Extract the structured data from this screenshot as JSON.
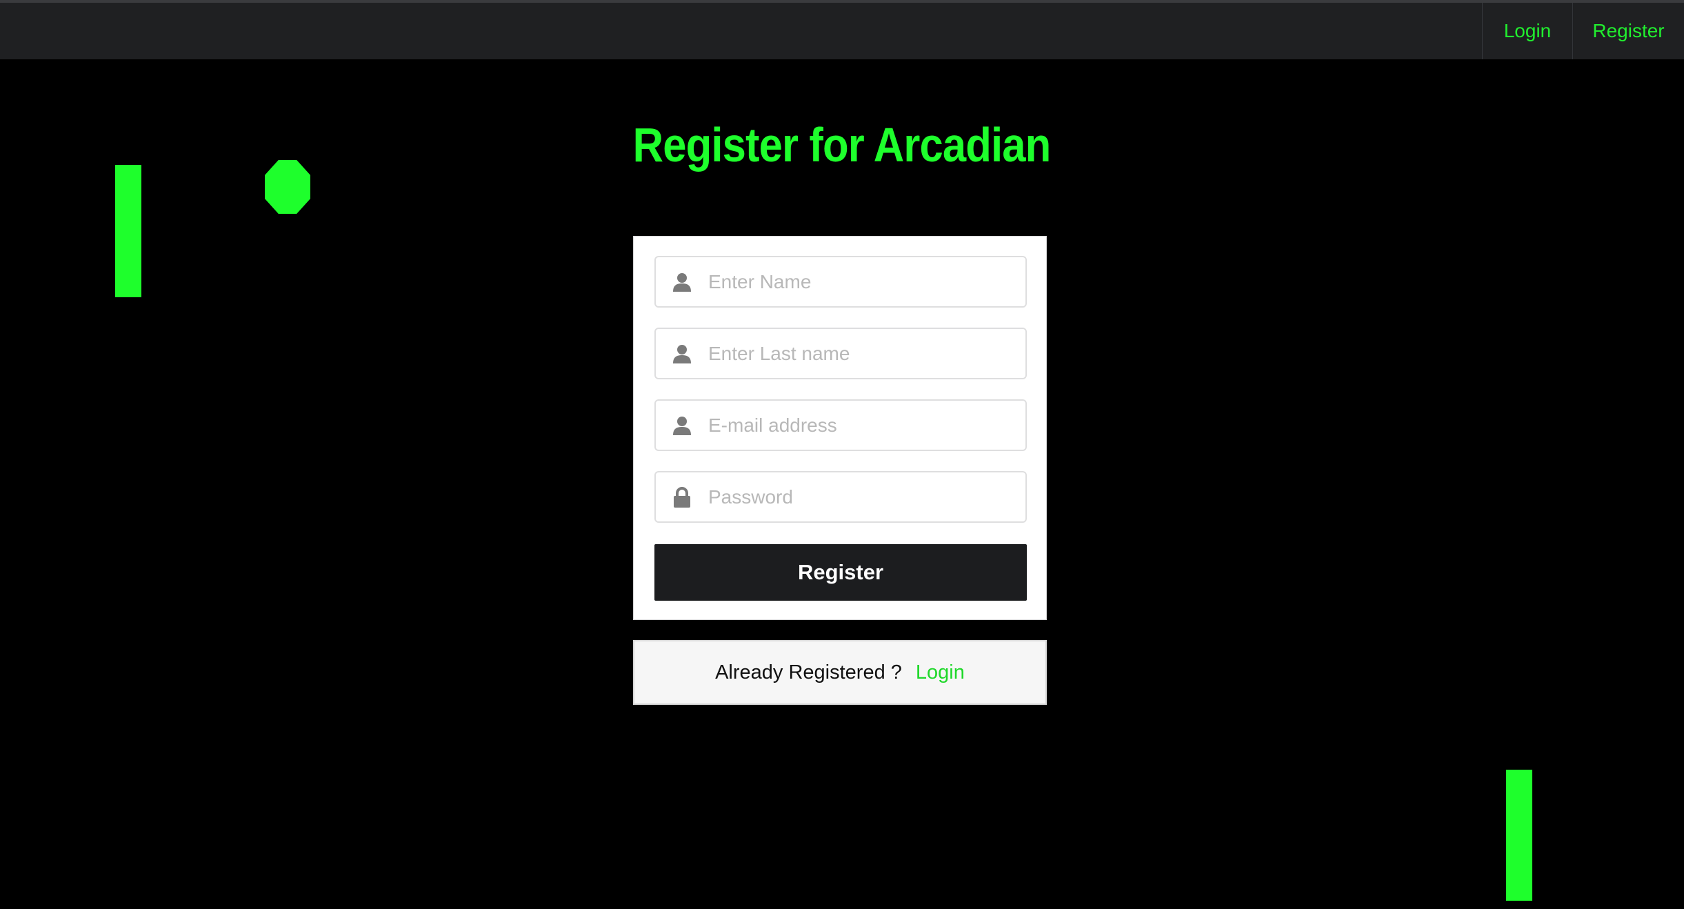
{
  "nav": {
    "login_label": "Login",
    "register_label": "Register"
  },
  "title": "Register for Arcadian",
  "form": {
    "name_placeholder": "Enter Name",
    "last_name_placeholder": "Enter Last name",
    "email_placeholder": "E-mail address",
    "password_placeholder": "Password",
    "submit_label": "Register"
  },
  "message": {
    "text": "Already Registered ?",
    "link_label": "Login"
  },
  "icons": {
    "name_field": "user-icon",
    "last_name_field": "user-icon",
    "email_field": "user-icon",
    "password_field": "lock-icon"
  },
  "colors": {
    "accent_green": "#1eff2c",
    "navbar_bg": "#1f2022",
    "page_bg": "#000000",
    "button_bg": "#1c1d1f"
  }
}
